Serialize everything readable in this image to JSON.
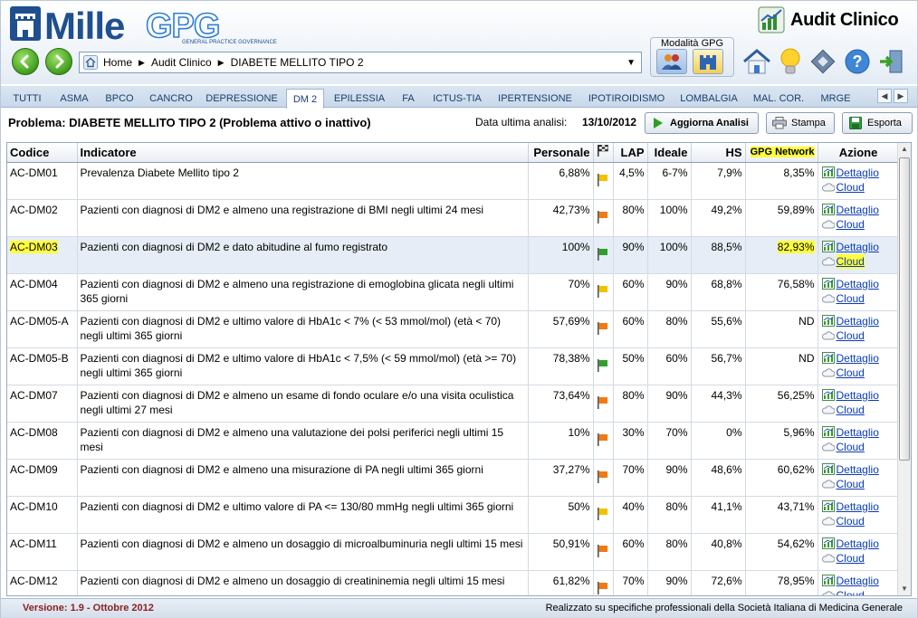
{
  "app": {
    "logo_text": "MilleGPG",
    "logo_subtitle": "GENERAL PRACTICE GOVERNANCE",
    "title": "Audit Clinico"
  },
  "breadcrumb": [
    "Home",
    "Audit Clinico",
    "DIABETE MELLITO TIPO 2"
  ],
  "mode": {
    "label": "Modalità GPG"
  },
  "tabs": [
    "TUTTI",
    "ASMA",
    "BPCO",
    "CANCRO",
    "DEPRESSIONE",
    "DM 2",
    "EPILESSIA",
    "FA",
    "ICTUS-TIA",
    "IPERTENSIONE",
    "IPOTIROIDISMO",
    "LOMBALGIA",
    "MAL. COR.",
    "MRGE"
  ],
  "active_tab": "DM 2",
  "problem": {
    "title": "Problema: DIABETE MELLITO TIPO 2 (Problema attivo o inattivo)",
    "analysis_label": "Data ultima analisi:",
    "analysis_date": "13/10/2012"
  },
  "buttons": {
    "update": "Aggiorna Analisi",
    "print": "Stampa",
    "export": "Esporta"
  },
  "table": {
    "columns": [
      "Codice",
      "Indicatore",
      "Personale",
      "",
      "LAP",
      "Ideale",
      "HS",
      "GPG Network",
      "Azione"
    ],
    "action_links": [
      "Dettaglio",
      "Cloud"
    ],
    "rows": [
      {
        "code": "AC-DM01",
        "indicator": "Prevalenza Diabete Mellito tipo 2",
        "personal": "6,88%",
        "flag": "yellow",
        "lap": "4,5%",
        "ideal": "6-7%",
        "hs": "7,9%",
        "network": "8,35%"
      },
      {
        "code": "AC-DM02",
        "indicator": "Pazienti con diagnosi di DM2 e almeno una registrazione di BMI negli ultimi 24 mesi",
        "personal": "42,73%",
        "flag": "orange",
        "lap": "80%",
        "ideal": "100%",
        "hs": "49,2%",
        "network": "59,89%"
      },
      {
        "code": "AC-DM03",
        "indicator": "Pazienti con diagnosi di DM2 e dato abitudine al fumo registrato",
        "personal": "100%",
        "flag": "green",
        "lap": "90%",
        "ideal": "100%",
        "hs": "88,5%",
        "network": "82,93%"
      },
      {
        "code": "AC-DM04",
        "indicator": "Pazienti con diagnosi di DM2 e almeno una registrazione di emoglobina glicata negli ultimi 365 giorni",
        "personal": "70%",
        "flag": "yellow",
        "lap": "60%",
        "ideal": "90%",
        "hs": "68,8%",
        "network": "76,58%"
      },
      {
        "code": "AC-DM05-A",
        "indicator": "Pazienti con diagnosi di DM2 e ultimo valore di HbA1c < 7% (< 53 mmol/mol) (età < 70) negli ultimi 365 giorni",
        "personal": "57,69%",
        "flag": "orange",
        "lap": "60%",
        "ideal": "80%",
        "hs": "55,6%",
        "network": "ND"
      },
      {
        "code": "AC-DM05-B",
        "indicator": "Pazienti con diagnosi di DM2 e ultimo valore di HbA1c < 7,5% (< 59 mmol/mol) (età >= 70) negli ultimi 365 giorni",
        "personal": "78,38%",
        "flag": "green",
        "lap": "50%",
        "ideal": "60%",
        "hs": "56,7%",
        "network": "ND"
      },
      {
        "code": "AC-DM07",
        "indicator": "Pazienti con diagnosi di DM2 e almeno un esame di fondo oculare e/o una visita oculistica negli ultimi 27 mesi",
        "personal": "73,64%",
        "flag": "orange",
        "lap": "80%",
        "ideal": "90%",
        "hs": "44,3%",
        "network": "56,25%"
      },
      {
        "code": "AC-DM08",
        "indicator": "Pazienti con diagnosi di DM2 e almeno una valutazione dei polsi periferici negli ultimi 15 mesi",
        "personal": "10%",
        "flag": "orange",
        "lap": "30%",
        "ideal": "70%",
        "hs": "0%",
        "network": "5,96%"
      },
      {
        "code": "AC-DM09",
        "indicator": "Pazienti con diagnosi di DM2 e almeno una misurazione di PA negli ultimi 365 giorni",
        "personal": "37,27%",
        "flag": "orange",
        "lap": "70%",
        "ideal": "90%",
        "hs": "48,6%",
        "network": "60,62%"
      },
      {
        "code": "AC-DM10",
        "indicator": "Pazienti con diagnosi di DM2 e ultimo valore di PA <= 130/80 mmHg negli ultimi 365 giorni",
        "personal": "50%",
        "flag": "yellow",
        "lap": "40%",
        "ideal": "80%",
        "hs": "41,1%",
        "network": "43,71%"
      },
      {
        "code": "AC-DM11",
        "indicator": "Pazienti con diagnosi di DM2 e almeno un dosaggio di microalbuminuria negli ultimi 15 mesi",
        "personal": "50,91%",
        "flag": "orange",
        "lap": "60%",
        "ideal": "80%",
        "hs": "40,8%",
        "network": "54,62%"
      },
      {
        "code": "AC-DM12",
        "indicator": "Pazienti con diagnosi di DM2 e almeno un dosaggio di creatininemia negli ultimi 15 mesi",
        "personal": "61,82%",
        "flag": "orange",
        "lap": "70%",
        "ideal": "90%",
        "hs": "72,6%",
        "network": "78,95%"
      }
    ]
  },
  "colors": {
    "green": "#2fa12b",
    "yellow": "#f2c200",
    "orange": "#f07a16",
    "highlight": "#ffff3c"
  },
  "status": {
    "version": "Versione: 1.9 - Ottobre 2012",
    "credit": "Realizzato su specifiche professionali della Società Italiana di Medicina Generale"
  }
}
